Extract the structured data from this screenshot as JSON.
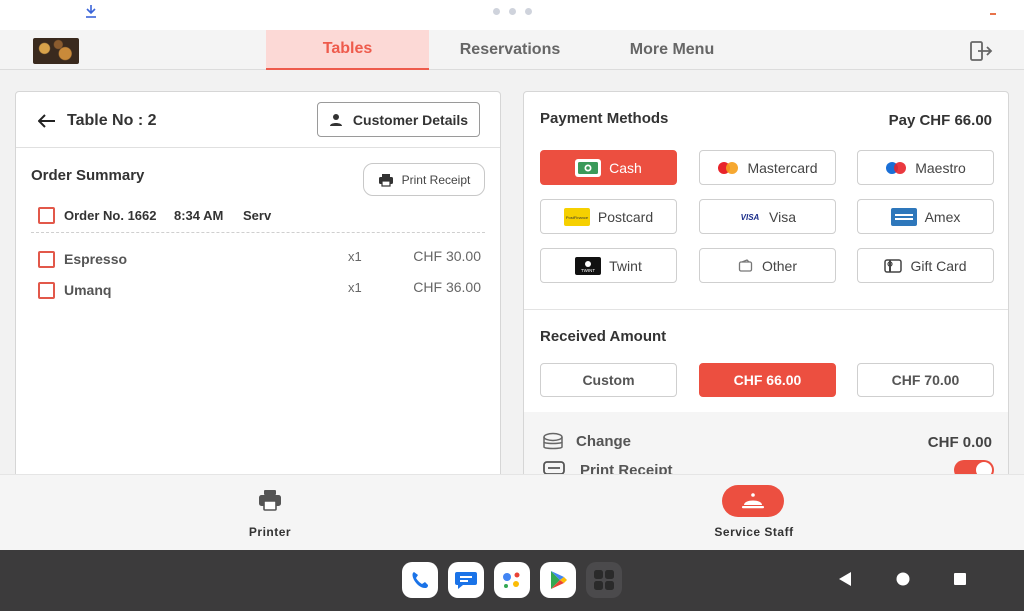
{
  "nav": {
    "tabs": [
      "Tables",
      "Reservations",
      "More Menu"
    ]
  },
  "order": {
    "table_title": "Table No : 2",
    "customer_details_label": "Customer Details",
    "summary_title": "Order Summary",
    "print_receipt_label": "Print Receipt",
    "order_no": "Order No. 1662",
    "time": "8:34 AM",
    "served_by": "Serv",
    "items": [
      {
        "name": "Espresso",
        "qty": "x1",
        "price": "CHF 30.00"
      },
      {
        "name": "Umanq",
        "qty": "x1",
        "price": "CHF 36.00"
      }
    ]
  },
  "payment": {
    "title": "Payment Methods",
    "pay_total": "Pay CHF 66.00",
    "methods": [
      {
        "label": "Cash",
        "icon": "cash-icon",
        "selected": true
      },
      {
        "label": "Mastercard",
        "icon": "mastercard-icon",
        "selected": false
      },
      {
        "label": "Maestro",
        "icon": "maestro-icon",
        "selected": false
      },
      {
        "label": "Postcard",
        "icon": "postfinance-card-icon",
        "selected": false
      },
      {
        "label": "Visa",
        "icon": "visa-icon",
        "selected": false
      },
      {
        "label": "Amex",
        "icon": "amex-icon",
        "selected": false
      },
      {
        "label": "Twint",
        "icon": "twint-icon",
        "selected": false
      },
      {
        "label": "Other",
        "icon": "wallet-icon",
        "selected": false
      },
      {
        "label": "Gift Card",
        "icon": "gift-card-icon",
        "selected": false
      }
    ],
    "postcard_logo_text": "PostFinance",
    "visa_logo_text": "VISA",
    "twint_logo_text": "TWINT",
    "received_title": "Received Amount",
    "amounts": [
      {
        "label": "Custom",
        "selected": false
      },
      {
        "label": "CHF 66.00",
        "selected": true
      },
      {
        "label": "CHF 70.00",
        "selected": false
      }
    ],
    "change_label": "Change",
    "change_value": "CHF 0.00",
    "print_receipt_label": "Print Receipt",
    "print_receipt_on": true
  },
  "bottom": {
    "printer_label": "Printer",
    "staff_label": "Service Staff"
  },
  "colors": {
    "accent": "#ec4f40",
    "tab_active_bg": "#fcd9d6",
    "navbar": "#3c3b3c"
  },
  "android": {
    "dock_apps": [
      "phone-app-icon",
      "messages-app-icon",
      "assistant-app-icon",
      "play-store-app-icon",
      "app-drawer-icon"
    ],
    "system_buttons": [
      "back-button",
      "home-button",
      "recents-button"
    ]
  }
}
